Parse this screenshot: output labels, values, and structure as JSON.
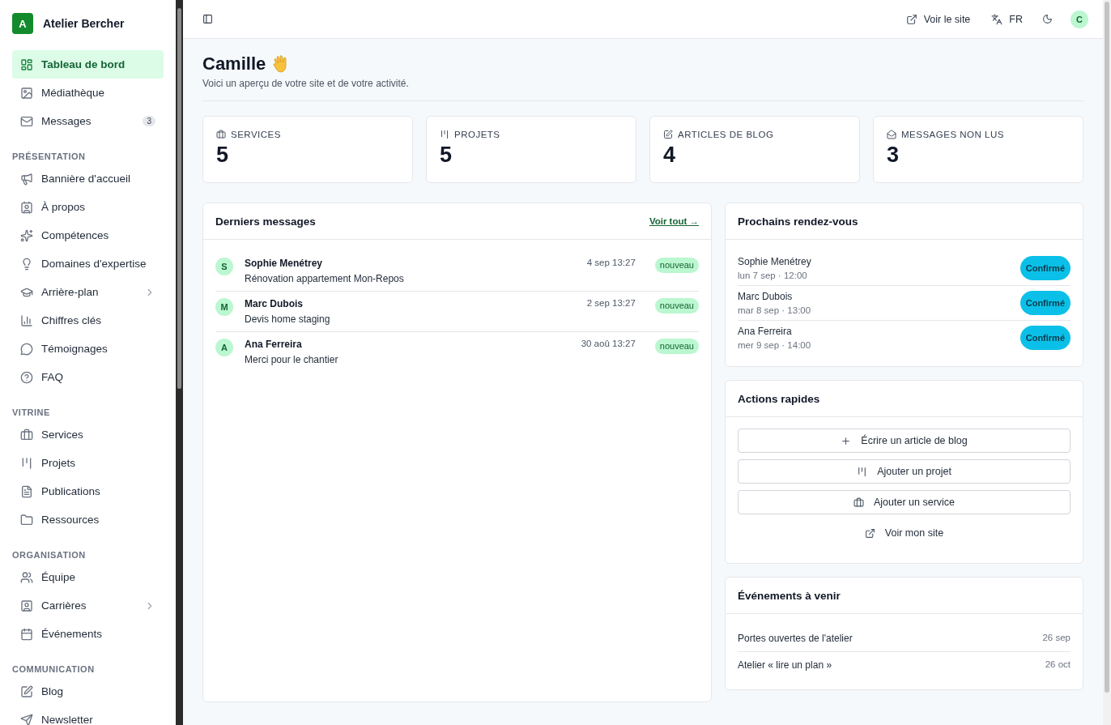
{
  "brand": {
    "initial": "A",
    "name": "Atelier Bercher"
  },
  "sidebar": {
    "top_items": [
      {
        "label": "Tableau de bord",
        "selected": true,
        "submenu": false
      },
      {
        "label": "Médiathèque",
        "selected": false,
        "submenu": false
      },
      {
        "label": "Messages",
        "selected": false,
        "submenu": false,
        "badge": "3"
      }
    ],
    "sections": [
      {
        "title": "PRÉSENTATION",
        "items": [
          {
            "label": "Bannière d'accueil",
            "selected": false,
            "submenu": false
          },
          {
            "label": "À propos",
            "selected": false,
            "submenu": false
          },
          {
            "label": "Compétences",
            "selected": false,
            "submenu": false
          },
          {
            "label": "Domaines d'expertise",
            "selected": false,
            "submenu": false
          },
          {
            "label": "Arrière-plan",
            "selected": false,
            "submenu": true
          },
          {
            "label": "Chiffres clés",
            "selected": false,
            "submenu": false
          },
          {
            "label": "Témoignages",
            "selected": false,
            "submenu": false
          },
          {
            "label": "FAQ",
            "selected": false,
            "submenu": false
          }
        ]
      },
      {
        "title": "VITRINE",
        "items": [
          {
            "label": "Services",
            "selected": false,
            "submenu": false
          },
          {
            "label": "Projets",
            "selected": false,
            "submenu": false
          },
          {
            "label": "Publications",
            "selected": false,
            "submenu": false
          },
          {
            "label": "Ressources",
            "selected": false,
            "submenu": false
          }
        ]
      },
      {
        "title": "ORGANISATION",
        "items": [
          {
            "label": "Équipe",
            "selected": false,
            "submenu": false
          },
          {
            "label": "Carrières",
            "selected": false,
            "submenu": true
          },
          {
            "label": "Événements",
            "selected": false,
            "submenu": false
          }
        ]
      },
      {
        "title": "COMMUNICATION",
        "items": [
          {
            "label": "Blog",
            "selected": false,
            "submenu": false
          },
          {
            "label": "Newsletter",
            "selected": false,
            "submenu": false
          }
        ]
      }
    ]
  },
  "topbar": {
    "site_link": "Voir le site",
    "language": "FR",
    "avatar": "C"
  },
  "greeting": {
    "title": "Camille",
    "subtitle": "Voici un aperçu de votre site et de votre activité."
  },
  "stats": [
    {
      "label": "SERVICES",
      "value": "5"
    },
    {
      "label": "PROJETS",
      "value": "5"
    },
    {
      "label": "ARTICLES DE BLOG",
      "value": "4"
    },
    {
      "label": "MESSAGES NON LUS",
      "value": "3"
    }
  ],
  "messages": {
    "title": "Derniers messages",
    "link": "Voir tout →",
    "items": [
      {
        "initial": "S",
        "name": "Sophie Menétrey",
        "subject": "Rénovation appartement Mon-Repos",
        "date": "4 sep 13:27",
        "status": "nouveau"
      },
      {
        "initial": "M",
        "name": "Marc Dubois",
        "subject": "Devis home staging",
        "date": "2 sep 13:27",
        "status": "nouveau"
      },
      {
        "initial": "A",
        "name": "Ana Ferreira",
        "subject": "Merci pour le chantier",
        "date": "30 aoû 13:27",
        "status": "nouveau"
      }
    ]
  },
  "appointments": {
    "title": "Prochains rendez-vous",
    "items": [
      {
        "name": "Sophie Menétrey",
        "when": "lun 7 sep · 12:00",
        "status": "Confirmé"
      },
      {
        "name": "Marc Dubois",
        "when": "mar 8 sep · 13:00",
        "status": "Confirmé"
      },
      {
        "name": "Ana Ferreira",
        "when": "mer 9 sep · 14:00",
        "status": "Confirmé"
      }
    ]
  },
  "quick_actions": {
    "title": "Actions rapides",
    "actions": [
      {
        "label": "Écrire un article de blog",
        "kind": "outlined"
      },
      {
        "label": "Ajouter un projet",
        "kind": "outlined"
      },
      {
        "label": "Ajouter un service",
        "kind": "outlined"
      },
      {
        "label": "Voir mon site",
        "kind": "ghost"
      }
    ]
  },
  "events": {
    "title": "Événements à venir",
    "items": [
      {
        "name": "Portes ouvertes de l'atelier",
        "date": "26 sep"
      },
      {
        "name": "Atelier « lire un plan »",
        "date": "26 oct"
      }
    ]
  }
}
